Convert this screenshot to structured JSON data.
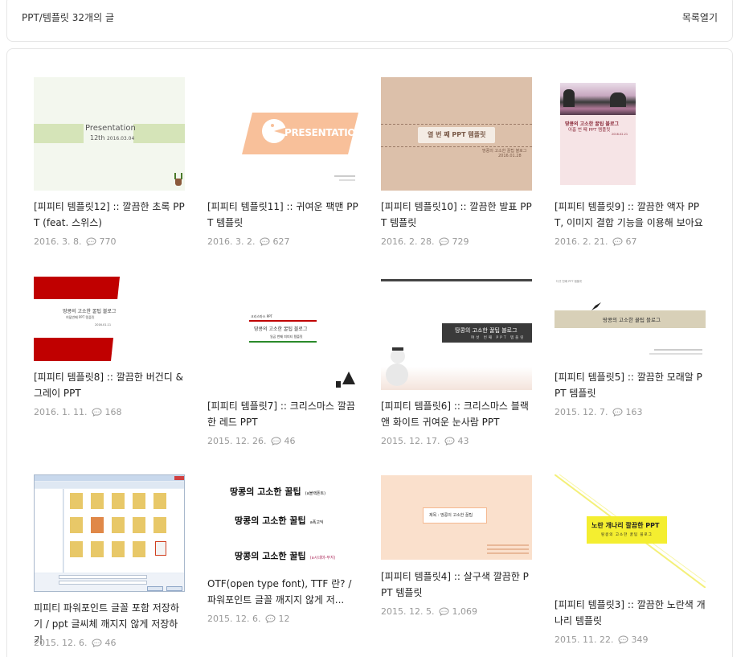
{
  "header": {
    "title": "PPT/템플릿 32개의 글",
    "toggle_label": "목록열기"
  },
  "posts": [
    {
      "title": "[피피티 템플릿12] :: 깔끔한 초록 PPT (feat. 스위스)",
      "date": "2016. 3. 8.",
      "comments": "770",
      "thumb": {
        "heading": "Presentation",
        "sub": "12th",
        "date": "2016.03.04"
      }
    },
    {
      "title": "[피피티 템플릿11] :: 귀여운 팩맨 PPT 템플릿",
      "date": "2016. 3. 2.",
      "comments": "627",
      "thumb": {
        "heading": "PRESENTATION"
      }
    },
    {
      "title": "[피피티 템플릿10] :: 깔끔한 발표 PPT 템플릿",
      "date": "2016. 2. 28.",
      "comments": "729",
      "thumb": {
        "heading": "열 번 째 PPT 템플릿",
        "caption": "땅콩의 고소한 꿀팁 블로그",
        "date": "2016.01.28"
      }
    },
    {
      "title": "[피피티 템플릿9] :: 깔끔한 액자 PPT, 이미지 결합 기능을 이용해 보아요",
      "date": "2016. 2. 21.",
      "comments": "67",
      "thumb": {
        "heading": "땅콩의 고소한 꿀팁 블로그",
        "sub": "아홉 번 째 PPT 템플릿",
        "date": "2016.02.21"
      }
    },
    {
      "title": "[피피티 템플릿8] :: 깔끔한 버건디 & 그레이 PPT",
      "date": "2016. 1. 11.",
      "comments": "168",
      "thumb": {
        "heading": "땅콩의 고소한 꿀팁 블로그",
        "sub": "여덟번째 PPT 템플릿",
        "date": "2016.01.11"
      }
    },
    {
      "title": "[피피티 템플릿7] :: 크리스마스 깔끔한 레드 PPT",
      "date": "2015. 12. 26.",
      "comments": "46",
      "thumb": {
        "label": "크리스마스 PPT",
        "heading": "땅콩의 고소한 꿀팁 블로그",
        "sub": "일곱 번째 피피티 템플릿"
      }
    },
    {
      "title": "[피피티 템플릿6] :: 크리스마스 블랙 앤 화이트 귀여운 눈사람 PPT",
      "date": "2015. 12. 17.",
      "comments": "43",
      "thumb": {
        "heading": "땅콩의 고소한 꿀팁 블로그",
        "sub": "여섯 번째 PPT 템플릿"
      }
    },
    {
      "title": "[피피티 템플릿5] :: 깔끔한 모래알 PPT 템플릿",
      "date": "2015. 12. 7.",
      "comments": "163",
      "thumb": {
        "heading": "땅콩의 고소한 꿀팁 블로그",
        "label": "다섯 번째 PPT 템플릿"
      }
    },
    {
      "title": "피피티 파워포인트 글꼴 포함 저장하기 / ppt 글씨체 깨지지 않게 저장하기",
      "date": "2015. 12. 6.",
      "comments": "46",
      "thumb": {}
    },
    {
      "title": "OTF(open type font), TTF 란? / 파워포인트 글꼴 깨지지 않게 저...",
      "date": "2015. 12. 6.",
      "comments": "12",
      "thumb": {
        "line1": "땅콩의 고소한 꿀팁",
        "tag1": "(a블랙폰트)",
        "line2": "땅콩의 고소한 꿀팁",
        "tag2": "a폭고딕",
        "line3": "땅콩의 고소한 꿀팁",
        "tag3": "(a시네마-부지)"
      }
    },
    {
      "title": "[피피티 템플릿4] :: 살구색 깔끔한 PPT 템플릿",
      "date": "2015. 12. 5.",
      "comments": "1,069",
      "thumb": {
        "heading": "제목 : 땅콩의 고소한 꿀팁"
      }
    },
    {
      "title": "[피피티 템플릿3] :: 깔끔한 노란색 개나리 템플릿",
      "date": "2015. 11. 22.",
      "comments": "349",
      "thumb": {
        "heading": "노란 개나리 깔끔한 PPT",
        "sub": "땅콩의 고소한 꿀팁 블로그"
      }
    }
  ]
}
